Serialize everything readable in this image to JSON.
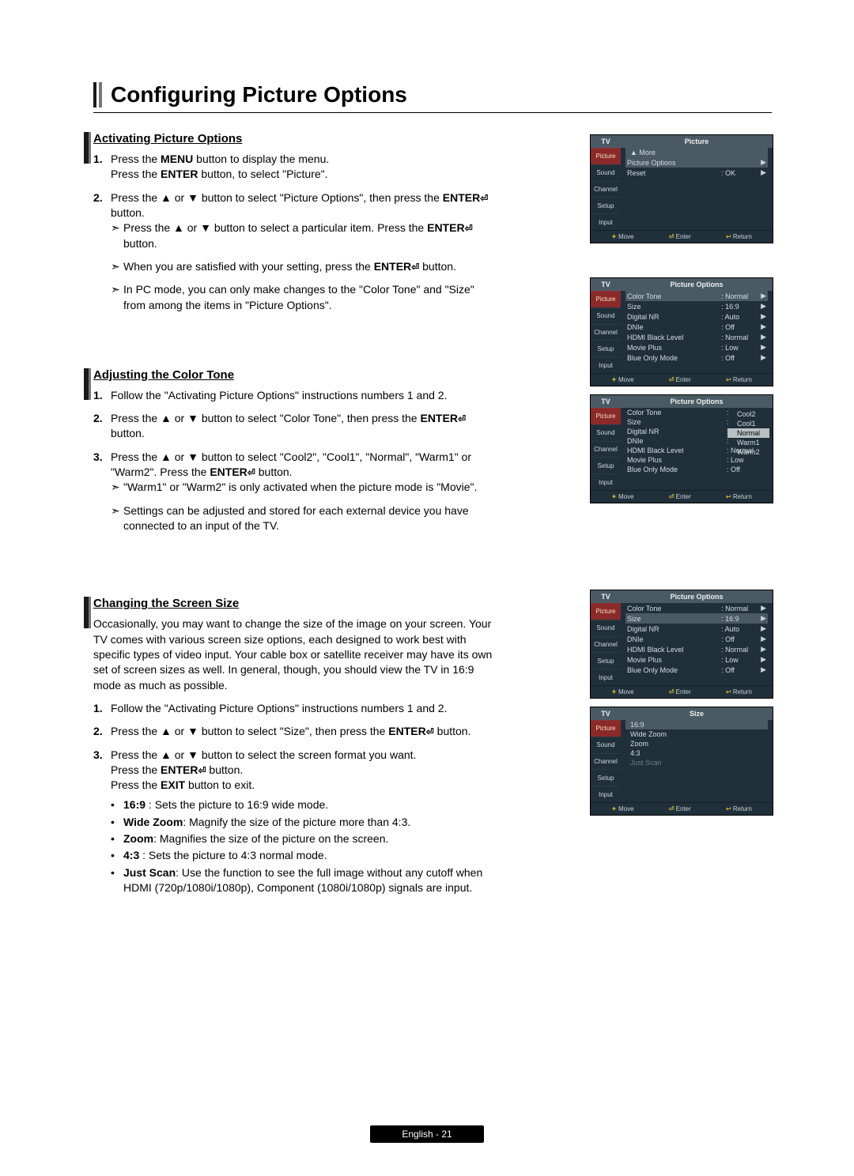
{
  "page": {
    "title": "Configuring Picture Options",
    "footer": "English - 21"
  },
  "activating": {
    "heading": "Activating Picture Options",
    "s1a": "Press the ",
    "s1b": "MENU",
    "s1c": " button to display the menu.",
    "s1d": "Press the ",
    "s1e": "ENTER",
    "s1f": " button, to select \"Picture\".",
    "s2a": "Press the ▲ or ▼ button to select \"Picture Options\", then press the ",
    "s2b": "ENTER",
    "s2c": " button.",
    "n1a": "Press the ▲ or ▼ button to select a particular item. Press the ",
    "n1b": "ENTER",
    "n1c": " button.",
    "n2a": "When you are satisfied with your setting, press the ",
    "n2b": "ENTER",
    "n2c": " button.",
    "n3": "In PC mode, you can only make changes to the \"Color Tone\" and \"Size\" from among the items in \"Picture Options\"."
  },
  "colortone": {
    "heading": "Adjusting the Color Tone",
    "s1": "Follow the \"Activating Picture Options\" instructions numbers 1 and 2.",
    "s2a": "Press the ▲ or ▼ button to select \"Color Tone\", then press the ",
    "s2b": "ENTER",
    "s2c": " button.",
    "s3a": "Press the ▲ or ▼ button to select \"Cool2\", \"Cool1\", \"Normal\", \"Warm1\" or \"Warm2\". Press the ",
    "s3b": "ENTER",
    "s3c": " button.",
    "n1": "\"Warm1\" or \"Warm2\" is only activated when the picture mode is \"Movie\".",
    "n2": "Settings can be adjusted and stored for each external device you have connected to an input of the TV."
  },
  "screensize": {
    "heading": "Changing the Screen Size",
    "intro": "Occasionally, you may want to change the size of the image on your screen. Your TV comes with various screen size options, each designed to work best with specific types of video input. Your cable box or satellite receiver may have its own set of screen sizes as well. In general, though, you should view the TV in 16:9 mode as much as possible.",
    "s1": "Follow the \"Activating Picture Options\" instructions numbers 1 and 2.",
    "s2a": "Press the ▲ or ▼ button to select \"Size\", then press the ",
    "s2b": "ENTER",
    "s2c": " button.",
    "s3a": "Press the ▲ or ▼ button to select the screen format you want.",
    "s3b": "Press the ",
    "s3c": "ENTER",
    "s3d": " button.",
    "s3e": "Press the ",
    "s3f": "EXIT",
    "s3g": " button to exit.",
    "opt16_9": "16:9",
    "opt16_9d": " : Sets the picture to 16:9 wide mode.",
    "optwz": "Wide Zoom",
    "optwzd": ": Magnify the size of the picture more than 4:3.",
    "optz": "Zoom",
    "optzd": ": Magnifies the size of the picture on the screen.",
    "opt43": "4:3",
    "opt43d": " : Sets the picture to 4:3 normal mode.",
    "optjs": "Just Scan",
    "optjsd": ": Use the function to see the full image without any cutoff when HDMI (720p/1080i/1080p), Component (1080i/1080p) signals are input."
  },
  "mock": {
    "tv": "TV",
    "nav": {
      "picture": "Picture",
      "sound": "Sound",
      "channel": "Channel",
      "setup": "Setup",
      "input": "Input"
    },
    "hdrPicture": "Picture",
    "hdrOptions": "Picture Options",
    "hdrSize": "Size",
    "more": "▲ More",
    "r_picopt": "Picture Options",
    "r_reset": "Reset",
    "v_ok": ": OK",
    "r_colortone": "Color Tone",
    "r_size": "Size",
    "r_dnr": "Digital NR",
    "r_dnie": "DNIe",
    "r_hdmi": "HDMI Black Level",
    "r_movieplus": "Movie Plus",
    "r_blue": "Blue Only Mode",
    "v_normal": ": Normal",
    "v_169": ": 16:9",
    "v_auto": ": Auto",
    "v_off": ": Off",
    "v_low": ": Low",
    "pop_cool2": "Cool2",
    "pop_cool1": "Cool1",
    "pop_normal": "Normal",
    "pop_warm1": "Warm1",
    "pop_warm2": "Warm2",
    "size_169": "16:9",
    "size_wz": "Wide Zoom",
    "size_z": "Zoom",
    "size_43": "4:3",
    "size_js": "Just Scan",
    "foot_move": "Move",
    "foot_enter": "Enter",
    "foot_return": "Return"
  }
}
